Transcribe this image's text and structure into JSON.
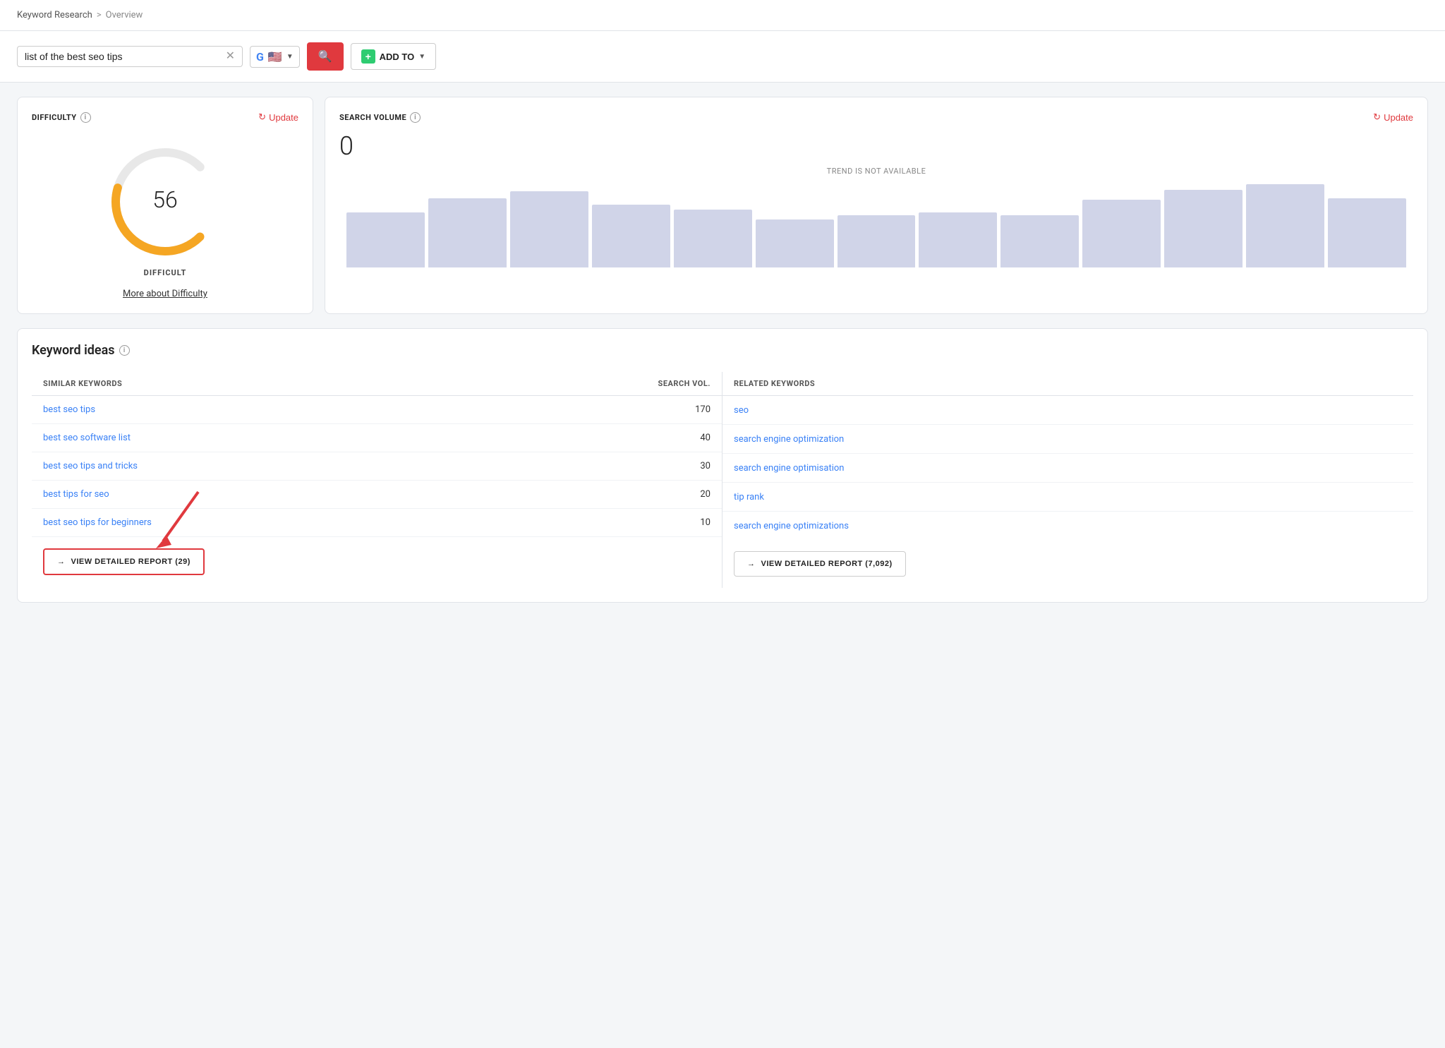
{
  "breadcrumb": {
    "parent": "Keyword Research",
    "separator": ">",
    "current": "Overview"
  },
  "search": {
    "query": "list of the best seo tips",
    "placeholder": "list of the best seo tips",
    "google_label": "G",
    "country_flag": "🇺🇸",
    "add_to_label": "ADD TO"
  },
  "difficulty": {
    "title": "DIFFICULTY",
    "value": 56,
    "label": "DIFFICULT",
    "update_label": "Update",
    "more_link": "More about Difficulty"
  },
  "search_volume": {
    "title": "SEARCH VOLUME",
    "value": "0",
    "trend_label": "TREND IS NOT AVAILABLE",
    "update_label": "Update",
    "bars": [
      55,
      75,
      80,
      65,
      60,
      50,
      55,
      60,
      55,
      75,
      85,
      90,
      75
    ]
  },
  "keyword_ideas": {
    "title": "Keyword ideas",
    "similar_header": "SIMILAR KEYWORDS",
    "search_vol_header": "SEARCH VOL.",
    "related_header": "RELATED KEYWORDS",
    "similar": [
      {
        "keyword": "best seo tips",
        "volume": "170"
      },
      {
        "keyword": "best seo software list",
        "volume": "40"
      },
      {
        "keyword": "best seo tips and tricks",
        "volume": "30"
      },
      {
        "keyword": "best tips for seo",
        "volume": "20"
      },
      {
        "keyword": "best seo tips for beginners",
        "volume": "10"
      }
    ],
    "related": [
      {
        "keyword": "seo"
      },
      {
        "keyword": "search engine optimization"
      },
      {
        "keyword": "search engine optimisation"
      },
      {
        "keyword": "tip rank"
      },
      {
        "keyword": "search engine optimizations"
      }
    ],
    "view_report_left": "VIEW DETAILED REPORT (29)",
    "view_report_right": "VIEW DETAILED REPORT (7,092)"
  }
}
